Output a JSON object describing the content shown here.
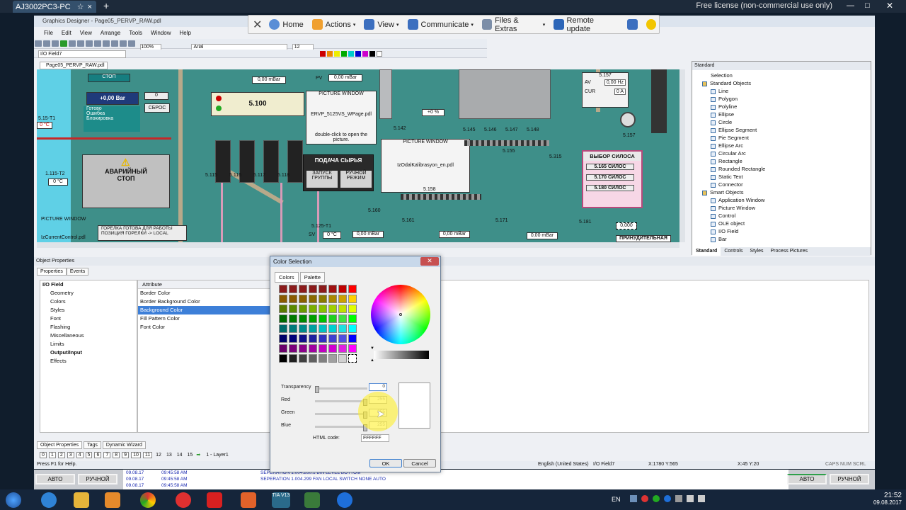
{
  "remote": {
    "tab_title": "AJ3002PC3-PC",
    "license": "Free license (non-commercial use only)",
    "menu": [
      {
        "label": "Home",
        "icon": "home-icon"
      },
      {
        "label": "Actions",
        "icon": "lightning-icon"
      },
      {
        "label": "View",
        "icon": "monitor-icon"
      },
      {
        "label": "Communicate",
        "icon": "phone-icon"
      },
      {
        "label": "Files & Extras",
        "icon": "files-icon"
      },
      {
        "label": "Remote update",
        "icon": "download-icon"
      }
    ]
  },
  "app": {
    "title": "Graphics Designer - Page05_PERVP_RAW.pdl",
    "menus": [
      "File",
      "Edit",
      "View",
      "Arrange",
      "Tools",
      "Window",
      "Help"
    ],
    "object_combo": "I/O Field7",
    "zoom": "100%",
    "font": "Arial",
    "font_size": "12",
    "doc_tab": "Page05_PERVP_RAW.pdl"
  },
  "canvas": {
    "labels": {
      "stop": "СТОП",
      "bar_value": "+0,00",
      "bar_unit": "Bar",
      "zero_val": "0",
      "reset": "СБРОС",
      "ready": "Готово",
      "error": "Ошибка",
      "block": "Блокировка",
      "t515": "5.15-T1",
      "t515v": "0 °C",
      "t1115": "1.115-T2",
      "t1115v": "0 °C",
      "emergency1": "АВАРИЙНЫЙ",
      "emergency2": "СТОП",
      "picture_window": "PICTURE WINDOW",
      "val_mbar": "0,00 mBar",
      "pv": "PV",
      "pv_val": "0,00 mBar",
      "m5100": "5.100",
      "dbl_click": "double-click to open the picture.",
      "file1": "ERVP_5125VS_WPage.pdl",
      "feed": "ПОДАЧА СЫРЬЯ",
      "group_start1": "ЗАПУСК",
      "group_start2": "ГРУППЫ",
      "manual1": "РУЧНОЙ",
      "manual2": "РЕЖИМ",
      "burner1": "ГОРЕЛКА ГОТОВА ДЛЯ РАБОТЫ",
      "burner2": "ПОЗИЦИЯ ГОРЕЛКИ -> LOCAL",
      "t5125": "5.125-T1",
      "sv": "SV",
      "sv_val": "0 °C",
      "m5142": "5.142",
      "pct": "+0 %",
      "file2": "IzOdalKalibrasyon_en.pdl",
      "m5155": "5.155",
      "m5315": "5.315",
      "m5158": "5.158",
      "m5160": "5.160",
      "m5161": "5.161",
      "m5171": "5.171",
      "m5181": "5.181",
      "m5157": "5.157",
      "av": "AV",
      "av_val": "0,00 Hz",
      "cur": "CUR",
      "cur_val": "0",
      "cur_unit": "A",
      "silo_sel": "ВЫБОР СИЛОСА",
      "silo1": "5.165 СИЛОС",
      "silo2": "5.170 СИЛОС",
      "silo3": "5.180 СИЛОС",
      "forced": "ПРИНУДИТЕЛЬНАЯ",
      "zero_val2": "0,000",
      "current_ctrl": "IzCurrentControl.pdl",
      "m5115": "5.115",
      "m5116": "5.116",
      "m5117": "5.117",
      "m5118": "5.118",
      "m5145": "5.145",
      "m5146": "5.146",
      "m5147": "5.147",
      "m5148": "5.148"
    }
  },
  "standard_panel": {
    "title": "Standard",
    "items": [
      {
        "label": "Selection",
        "level": 0
      },
      {
        "label": "Standard Objects",
        "level": 0
      },
      {
        "label": "Line",
        "level": 1
      },
      {
        "label": "Polygon",
        "level": 1
      },
      {
        "label": "Polyline",
        "level": 1
      },
      {
        "label": "Ellipse",
        "level": 1
      },
      {
        "label": "Circle",
        "level": 1
      },
      {
        "label": "Ellipse Segment",
        "level": 1
      },
      {
        "label": "Pie Segment",
        "level": 1
      },
      {
        "label": "Ellipse Arc",
        "level": 1
      },
      {
        "label": "Circular Arc",
        "level": 1
      },
      {
        "label": "Rectangle",
        "level": 1
      },
      {
        "label": "Rounded Rectangle",
        "level": 1
      },
      {
        "label": "Static Text",
        "level": 1
      },
      {
        "label": "Connector",
        "level": 1
      },
      {
        "label": "Smart Objects",
        "level": 0
      },
      {
        "label": "Application Window",
        "level": 1
      },
      {
        "label": "Picture Window",
        "level": 1
      },
      {
        "label": "Control",
        "level": 1
      },
      {
        "label": "OLE object",
        "level": 1
      },
      {
        "label": "I/O Field",
        "level": 1
      },
      {
        "label": "Bar",
        "level": 1
      }
    ],
    "tabs": [
      "Standard",
      "Controls",
      "Styles",
      "Process Pictures"
    ]
  },
  "object_properties": {
    "title": "Object Properties",
    "tabs": [
      "Properties",
      "Events"
    ],
    "tree": [
      "I/O Field",
      "Geometry",
      "Colors",
      "Styles",
      "Font",
      "Flashing",
      "Miscellaneous",
      "Limits",
      "Output/Input",
      "Effects"
    ],
    "attr_header": "Attribute",
    "attrs": [
      "Border Color",
      "Border Background Color",
      "Background Color",
      "Fill Pattern Color",
      "Font Color"
    ],
    "bottom_tabs": [
      "Object Properties",
      "Tags",
      "Dynamic Wizard"
    ],
    "layers": [
      "0",
      "1",
      "2",
      "3",
      "4",
      "5",
      "6",
      "7",
      "8",
      "9",
      "10",
      "11",
      "12",
      "13",
      "14",
      "15"
    ],
    "layer_label": "1 - Layer1"
  },
  "status": {
    "help": "Press F1 for Help.",
    "lang": "English (United States)",
    "obj": "I/O Field7",
    "xy": "X:1780 Y:565",
    "pos": "X:45 Y:20",
    "caps": "CAPS NUM SCRL"
  },
  "hmi_bottom": {
    "auto": "АВТО",
    "manual": "РУЧНОЙ",
    "dates": [
      "09.08.17",
      "09.08.17",
      "09.08.17"
    ],
    "times": [
      "09:45:58 AM",
      "09:45:58 AM",
      "09:45:58 AM"
    ],
    "msgs": [
      "SEPERATION 1.004.260.1 BIN LEVEL BOTTOM",
      "SEPERATION 1.004.299 FAN LOCAL SWITCH NONE AUTO"
    ]
  },
  "color_dialog": {
    "title": "Color Selection",
    "tabs": [
      "Colors",
      "Palette"
    ],
    "transparency_label": "Transparency",
    "transparency": "0",
    "red_label": "Red",
    "red": "255",
    "green_label": "Green",
    "green": "255",
    "blue_label": "Blue",
    "blue": "255",
    "html_label": "HTML code:",
    "html": "FFFFFF",
    "ok": "OK",
    "cancel": "Cancel",
    "swatches": [
      "#8b1a1a",
      "#8b1a1a",
      "#8b1a1a",
      "#8b1a1a",
      "#8b1a1a",
      "#a01010",
      "#c00000",
      "#ff0000",
      "#8a5a00",
      "#8a5a00",
      "#8a6000",
      "#8a6a00",
      "#8a7a00",
      "#aa8800",
      "#cca000",
      "#ffd000",
      "#5a7a00",
      "#5a8a00",
      "#6a9a00",
      "#7ab000",
      "#8ac000",
      "#a0d000",
      "#c0e000",
      "#e0ff00",
      "#006a00",
      "#007a00",
      "#008a00",
      "#00a000",
      "#00c000",
      "#20d020",
      "#40e040",
      "#00ff00",
      "#006a6a",
      "#007a7a",
      "#008a8a",
      "#00a0a0",
      "#00c0c0",
      "#00d0d0",
      "#20e0e0",
      "#00ffff",
      "#00006a",
      "#00007a",
      "#10108a",
      "#2020a0",
      "#3030c0",
      "#4040d0",
      "#5050e0",
      "#0000ff",
      "#6a006a",
      "#7a007a",
      "#8a008a",
      "#a000a0",
      "#c000c0",
      "#d000d0",
      "#e020e0",
      "#ff00ff",
      "#000000",
      "#202020",
      "#404040",
      "#606060",
      "#808080",
      "#a0a0a0",
      "#d0d0d0",
      "#ffffff"
    ]
  },
  "taskbar": {
    "lang": "EN",
    "time": "21:52",
    "date": "09.08.2017",
    "tia": "TIA V13"
  }
}
